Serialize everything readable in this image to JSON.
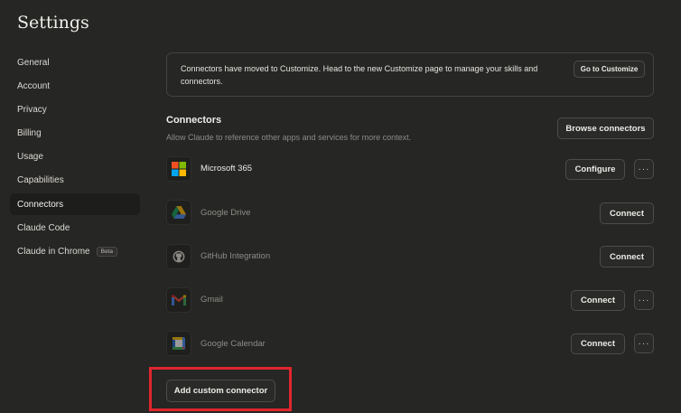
{
  "page_title": "Settings",
  "sidebar": {
    "items": [
      {
        "label": "General"
      },
      {
        "label": "Account"
      },
      {
        "label": "Privacy"
      },
      {
        "label": "Billing"
      },
      {
        "label": "Usage"
      },
      {
        "label": "Capabilities"
      },
      {
        "label": "Connectors",
        "active": true
      },
      {
        "label": "Claude Code"
      },
      {
        "label": "Claude in Chrome",
        "badge": "Beta"
      }
    ]
  },
  "notice": {
    "text": "Connectors have moved to Customize. Head to the new Customize page to manage your skills and connectors.",
    "button": "Go to Customize"
  },
  "connectors": {
    "title": "Connectors",
    "subtitle": "Allow Claude to reference other apps and services for more context.",
    "browse_button": "Browse connectors",
    "add_custom_button": "Add custom connector",
    "more_label": "···",
    "items": [
      {
        "name": "Microsoft 365",
        "action": "Configure",
        "icon": "microsoft-365-icon"
      },
      {
        "name": "Google Drive",
        "action": "Connect",
        "icon": "google-drive-icon"
      },
      {
        "name": "GitHub Integration",
        "action": "Connect",
        "icon": "github-icon"
      },
      {
        "name": "Gmail",
        "action": "Connect",
        "icon": "gmail-icon"
      },
      {
        "name": "Google Calendar",
        "action": "Connect",
        "icon": "google-calendar-icon"
      }
    ]
  },
  "colors": {
    "background": "#262624",
    "highlight_box": "#e0262e"
  }
}
